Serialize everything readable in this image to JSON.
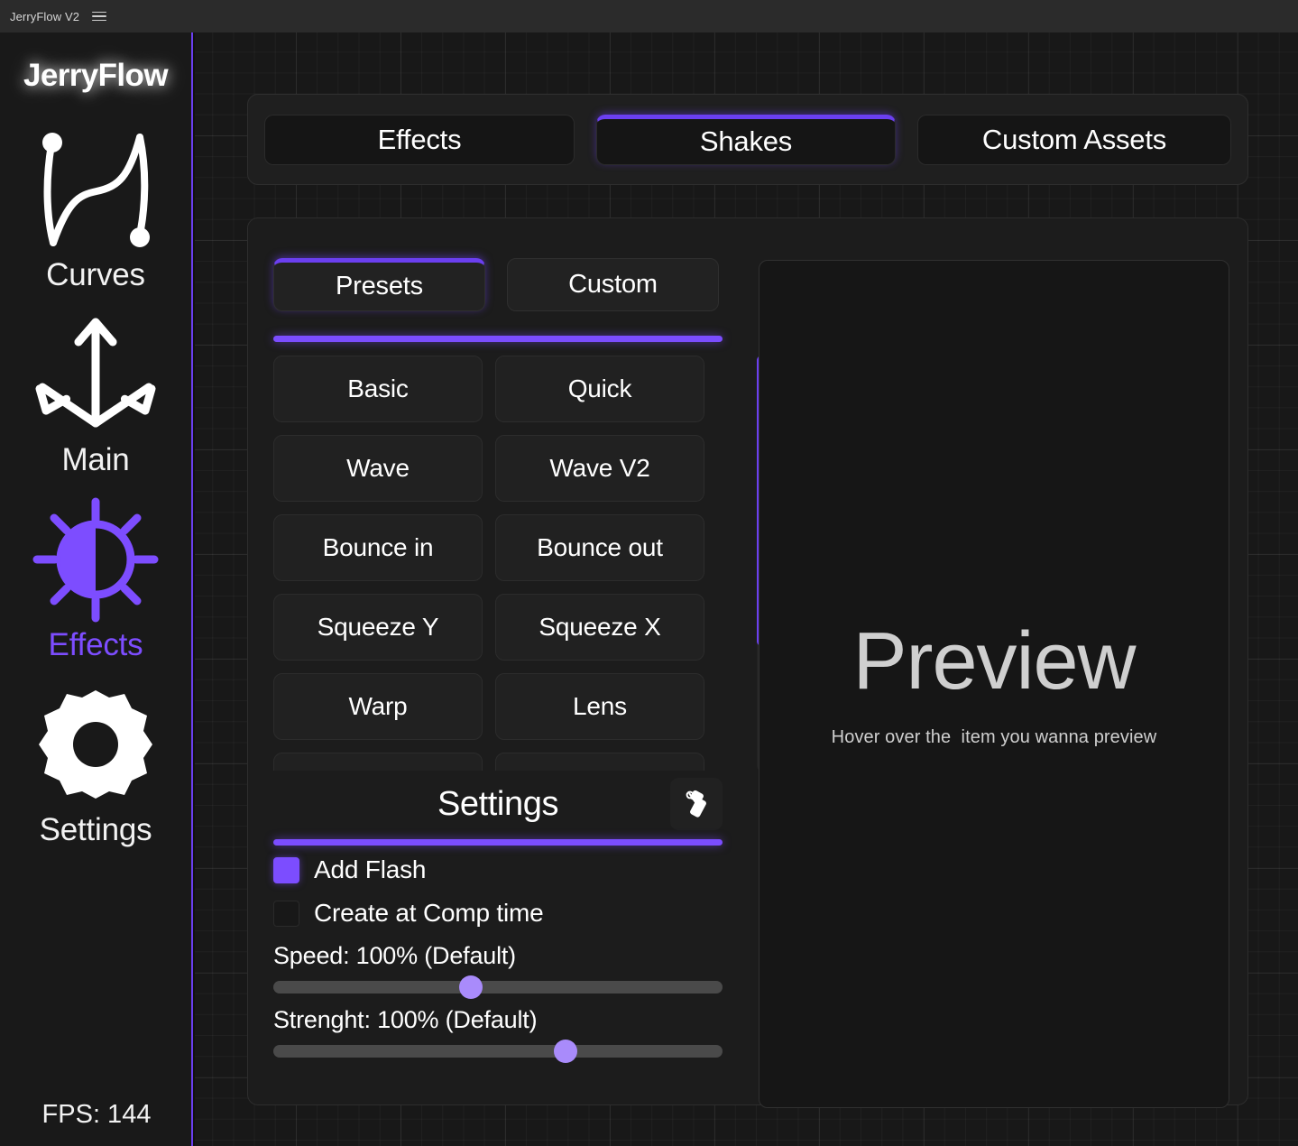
{
  "titlebar": {
    "app_title": "JerryFlow V2",
    "menu_icon": "hamburger-menu-icon"
  },
  "sidebar": {
    "brand": "JerryFlow",
    "fps": "FPS: 144",
    "accent_color": "#7d4dff",
    "items": [
      {
        "label": "Curves",
        "icon": "curves-icon",
        "active": false
      },
      {
        "label": "Main",
        "icon": "anchor-arrows-icon",
        "active": false
      },
      {
        "label": "Effects",
        "icon": "brightness-sun-icon",
        "active": true
      },
      {
        "label": "Settings",
        "icon": "gear-icon",
        "active": false
      }
    ]
  },
  "top_tabs": [
    {
      "label": "Effects",
      "active": false
    },
    {
      "label": "Shakes",
      "active": true
    },
    {
      "label": "Custom Assets",
      "active": false
    }
  ],
  "sub_tabs": [
    {
      "label": "Presets",
      "active": true
    },
    {
      "label": "Custom",
      "active": false
    }
  ],
  "presets": [
    "Basic",
    "Quick",
    "Wave",
    "Wave V2",
    "Bounce in",
    "Bounce out",
    "Squeeze Y",
    "Squeeze X",
    "Warp",
    "Lens",
    "",
    ""
  ],
  "scrollbar": {
    "thumb_top_pct": 0,
    "thumb_height_pct": 70,
    "thumb_color": "#6b3ff0"
  },
  "settings": {
    "title": "Settings",
    "icon": "tool-wrench-icon",
    "checkboxes": [
      {
        "label": "Add Flash",
        "checked": true
      },
      {
        "label": "Create at Comp time",
        "checked": false
      }
    ],
    "sliders": [
      {
        "label": "Speed: 100% (Default)",
        "value_pct": 44
      },
      {
        "label": "Strenght: 100% (Default)",
        "value_pct": 65
      }
    ]
  },
  "preview": {
    "title": "Preview",
    "subtitle": "Hover over the  item you wanna preview"
  }
}
